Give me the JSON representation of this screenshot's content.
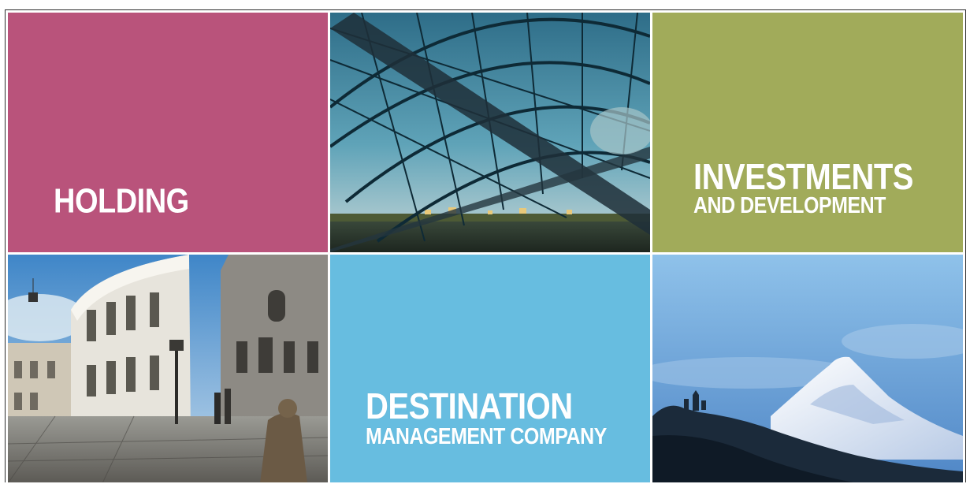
{
  "tiles": {
    "holding": {
      "title": "HOLDING",
      "color": "#b9537b"
    },
    "bridge_photo": {
      "icon": "glass-bridge-photo"
    },
    "investments": {
      "title": "INVESTMENTS",
      "subtitle": "AND DEVELOPMENT",
      "color": "#a1ab5a"
    },
    "old_town_photo": {
      "icon": "old-town-street-photo"
    },
    "destination": {
      "title": "DESTINATION",
      "subtitle": "MANAGEMENT COMPANY",
      "color": "#67bde0"
    },
    "mountain_photo": {
      "icon": "snowy-mountain-photo"
    }
  }
}
